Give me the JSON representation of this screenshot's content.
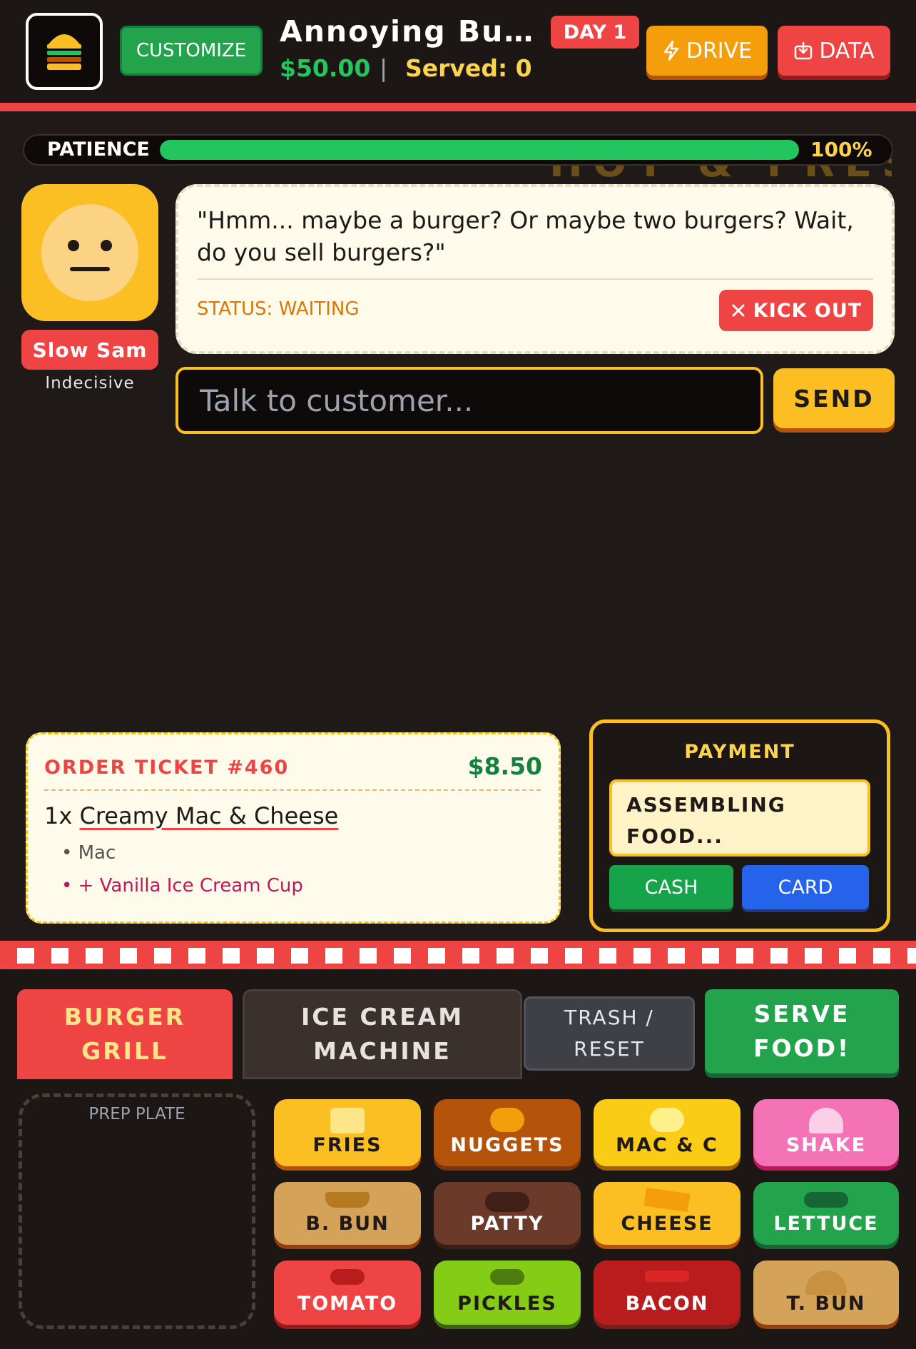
{
  "header": {
    "customize_label": "CUSTOMIZE",
    "restaurant_name": "Annoying Burger Shack",
    "money": "$50.00",
    "separator": "|",
    "served": "Served: 0",
    "day": "DAY 1",
    "drive_label": "DRIVE",
    "data_label": "DATA"
  },
  "patience": {
    "label": "PATIENCE",
    "percent_text": "100%",
    "level": 1.0,
    "sign_text": "HOT & FRESH"
  },
  "customer": {
    "name": "Slow Sam",
    "trait": "Indecisive",
    "quote": "\"Hmm... maybe a burger? Or maybe two burgers? Wait, do you sell burgers?\"",
    "status": "STATUS: WAITING",
    "kick_label": "KICK OUT"
  },
  "chat": {
    "placeholder": "Talk to customer...",
    "send_label": "SEND"
  },
  "ticket": {
    "title": "ORDER TICKET #460",
    "price": "$8.50",
    "qty": "1x",
    "item": "Creamy Mac & Cheese",
    "modifiers": [
      "• Mac",
      "• + Vanilla Ice Cream Cup"
    ]
  },
  "payment": {
    "title": "PAYMENT",
    "status": "ASSEMBLING FOOD...",
    "cash_label": "CASH",
    "card_label": "CARD"
  },
  "tabs": {
    "grill": "BURGER GRILL",
    "ice_cream": "ICE CREAM MACHINE",
    "trash": "TRASH / RESET",
    "serve": "SERVE FOOD!"
  },
  "prep_plate": "PREP PLATE",
  "ingredients": [
    {
      "label": "FRIES",
      "color": "#fbbf24"
    },
    {
      "label": "NUGGETS",
      "color": "#b45309"
    },
    {
      "label": "MAC & C",
      "color": "#facc15"
    },
    {
      "label": "SHAKE",
      "color": "#f472b6"
    },
    {
      "label": "B. BUN",
      "color": "#d4a259"
    },
    {
      "label": "PATTY",
      "color": "#6b3a2a"
    },
    {
      "label": "CHEESE",
      "color": "#fbbf24"
    },
    {
      "label": "LETTUCE",
      "color": "#22a34c"
    },
    {
      "label": "TOMATO",
      "color": "#ef4444"
    },
    {
      "label": "PICKLES",
      "color": "#84cc16"
    },
    {
      "label": "BACON",
      "color": "#b91c1c"
    },
    {
      "label": "T. BUN",
      "color": "#d4a259"
    }
  ]
}
